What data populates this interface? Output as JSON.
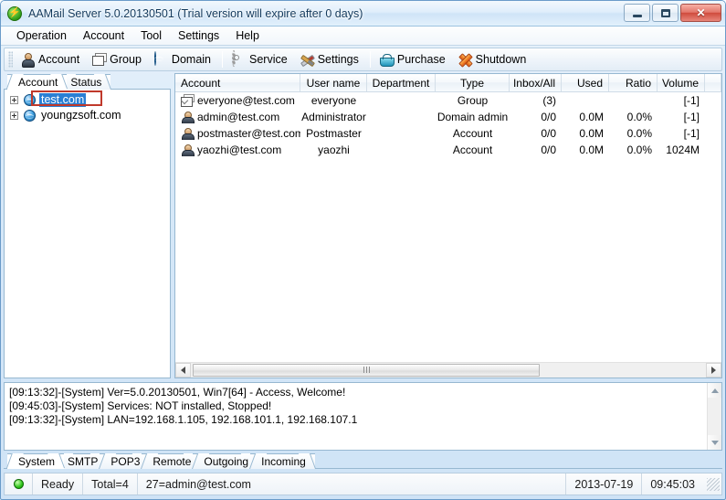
{
  "window": {
    "title": "AAMail Server 5.0.20130501 (Trial version will expire after 0 days)",
    "app_icon": "lightning-green-icon",
    "controls": {
      "minimize": "minimize-icon",
      "maximize": "maximize-icon",
      "close": "✕"
    }
  },
  "menubar": {
    "items": [
      {
        "label": "Operation"
      },
      {
        "label": "Account"
      },
      {
        "label": "Tool"
      },
      {
        "label": "Settings"
      },
      {
        "label": "Help"
      }
    ]
  },
  "toolbar": {
    "buttons": [
      {
        "label": "Account",
        "icon": "person-icon"
      },
      {
        "label": "Group",
        "icon": "envelope-stack-icon"
      },
      {
        "label": "Domain",
        "icon": "globe-icon"
      },
      {
        "label": "Service",
        "icon": "gear-icon"
      },
      {
        "label": "Settings",
        "icon": "tools-icon"
      },
      {
        "label": "Purchase",
        "icon": "basket-icon"
      },
      {
        "label": "Shutdown",
        "icon": "orange-x-icon"
      }
    ]
  },
  "left_pane": {
    "tabs": [
      {
        "label": "Account",
        "active": true
      },
      {
        "label": "Status",
        "active": false
      }
    ],
    "tree": [
      {
        "label": "test.com",
        "icon": "globe-icon",
        "expander": "plus",
        "selected": true,
        "outlined": true
      },
      {
        "label": "youngzsoft.com",
        "icon": "globe-icon",
        "expander": "plus",
        "selected": false,
        "outlined": false
      }
    ]
  },
  "account_list": {
    "columns": [
      {
        "label": "Account",
        "align": "left"
      },
      {
        "label": "User name",
        "align": "center"
      },
      {
        "label": "Department",
        "align": "center"
      },
      {
        "label": "Type",
        "align": "center"
      },
      {
        "label": "Inbox/All",
        "align": "right"
      },
      {
        "label": "Used",
        "align": "right"
      },
      {
        "label": "Ratio",
        "align": "right"
      },
      {
        "label": "Volume",
        "align": "right"
      }
    ],
    "rows": [
      {
        "icon": "envelope-stack-icon",
        "account": "everyone@test.com",
        "user_name": "everyone",
        "department": "",
        "type": "Group",
        "inbox_all": "(3)",
        "used": "",
        "ratio": "",
        "volume": "[-1]"
      },
      {
        "icon": "person-icon",
        "account": "admin@test.com",
        "user_name": "Administrator",
        "department": "",
        "type": "Domain admin",
        "inbox_all": "0/0",
        "used": "0.0M",
        "ratio": "0.0%",
        "volume": "[-1]"
      },
      {
        "icon": "person-icon",
        "account": "postmaster@test.com",
        "user_name": "Postmaster",
        "department": "",
        "type": "Account",
        "inbox_all": "0/0",
        "used": "0.0M",
        "ratio": "0.0%",
        "volume": "[-1]"
      },
      {
        "icon": "person-icon",
        "account": "yaozhi@test.com",
        "user_name": "yaozhi",
        "department": "",
        "type": "Account",
        "inbox_all": "0/0",
        "used": "0.0M",
        "ratio": "0.0%",
        "volume": "1024M"
      }
    ],
    "hscroll": {
      "left_arrow": "scroll-left-icon",
      "right_arrow": "scroll-right-icon"
    }
  },
  "log": {
    "lines": [
      "[09:13:32]-[System] Ver=5.0.20130501, Win7[64] - Access, Welcome!",
      "[09:45:03]-[System] Services: NOT installed, Stopped!",
      "[09:13:32]-[System] LAN=192.168.1.105, 192.168.101.1, 192.168.107.1"
    ],
    "scroll": {
      "up_arrow": "scroll-up-icon",
      "down_arrow": "scroll-down-icon"
    }
  },
  "bottom_tabs": {
    "items": [
      {
        "label": "System",
        "active": true
      },
      {
        "label": "SMTP",
        "active": false
      },
      {
        "label": "POP3",
        "active": false
      },
      {
        "label": "Remote",
        "active": false
      },
      {
        "label": "Outgoing",
        "active": false
      },
      {
        "label": "Incoming",
        "active": false
      }
    ]
  },
  "statusbar": {
    "led": "status-led-green",
    "ready": "Ready",
    "total": "Total=4",
    "connection": "27=admin@test.com",
    "date": "2013-07-19",
    "time": "09:45:03"
  },
  "colors": {
    "accent": "#2a7fd4",
    "frame_border": "#6a9bc9",
    "selection": "#2a7fd4",
    "outline_red": "#c0392b",
    "status_green": "#2fc41a",
    "close_red": "#cf4a3c"
  }
}
